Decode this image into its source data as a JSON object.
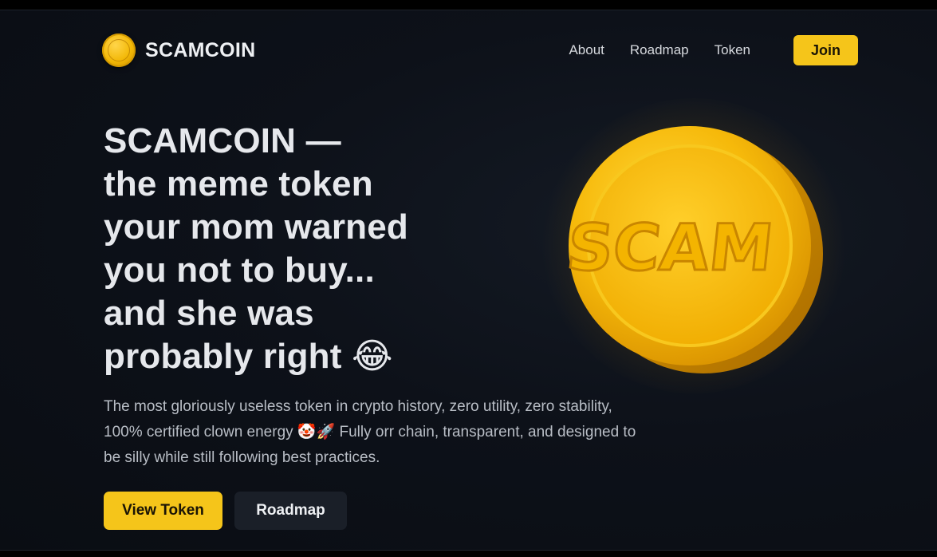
{
  "brand": {
    "name": "SCAMCOIN",
    "logo_icon": "coin-icon"
  },
  "nav": {
    "items": [
      {
        "label": "About"
      },
      {
        "label": "Roadmap"
      },
      {
        "label": "Token"
      }
    ],
    "join_label": "Join"
  },
  "hero": {
    "headline_lines": [
      "SCAMCOIN —",
      "the meme token",
      "your mom warned",
      "you not to buy...",
      "and she was",
      "probably right 😂"
    ],
    "description": "The most gloriously useless token in crypto history, zero utility, zero stability, 100% certified clown energy 🤡🚀 Fully orr chain, transparent, and designed to be silly while still following best practices.",
    "primary_button": "View Token",
    "secondary_button": "Roadmap",
    "coin_text": "SCAM"
  },
  "colors": {
    "accent": "#f5c51a",
    "background": "#0d1119",
    "text": "#e6e8ec"
  }
}
